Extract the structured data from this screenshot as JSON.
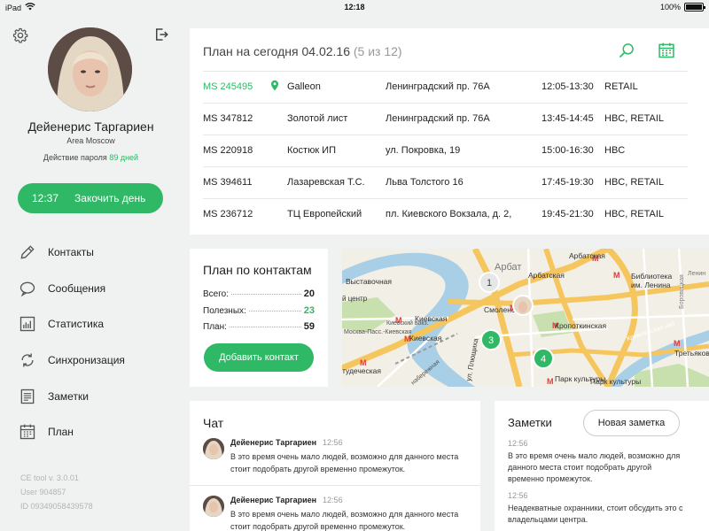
{
  "statusbar": {
    "device": "iPad",
    "time": "12:18",
    "battery_label": "100%",
    "battery_level": 1.0
  },
  "profile": {
    "name": "Дейенерис Таргариен",
    "region": "Area Moscow",
    "password_prefix": "Действие пароля",
    "password_days": "89 дней"
  },
  "end_day": {
    "time": "12:37",
    "label": "Закочить день"
  },
  "nav": [
    {
      "label": "Контакты",
      "icon": "pencil-icon"
    },
    {
      "label": "Сообщения",
      "icon": "chat-bubble-icon"
    },
    {
      "label": "Статистика",
      "icon": "bar-chart-icon"
    },
    {
      "label": "Синхронизация",
      "icon": "sync-icon"
    },
    {
      "label": "Заметки",
      "icon": "notes-icon"
    },
    {
      "label": "План",
      "icon": "calendar-icon"
    }
  ],
  "meta": {
    "version": "CE tool v. 3.0.01",
    "user": "User 904857",
    "id": "ID 09349058439578"
  },
  "plan": {
    "title": "План на сегодня 04.02.16",
    "count": "(5 из 12)",
    "rows": [
      {
        "id": "MS 245495",
        "name": "Galleon",
        "address": "Ленинградский пр. 76А",
        "time": "12:05-13:30",
        "type": "RETAIL"
      },
      {
        "id": "MS 347812",
        "name": "Золотой лист",
        "address": "Ленинградский пр. 76А",
        "time": "13:45-14:45",
        "type": "HBC, RETAIL"
      },
      {
        "id": "MS 220918",
        "name": "Костюк ИП",
        "address": "ул. Покровка, 19",
        "time": "15:00-16:30",
        "type": "HBC"
      },
      {
        "id": "MS 394611",
        "name": "Лазаревская Т.С.",
        "address": "Льва Толстого 16",
        "time": "17:45-19:30",
        "type": "HBC, RETAIL"
      },
      {
        "id": "MS 236712",
        "name": "ТЦ Европейский",
        "address": "пл. Киевского Вокзала, д. 2,",
        "time": "19:45-21:30",
        "type": "HBC, RETAIL"
      }
    ]
  },
  "contacts_plan": {
    "title": "План по контактам",
    "rows": [
      {
        "label": "Всего:",
        "value": "20"
      },
      {
        "label": "Полезных:",
        "value": "23"
      },
      {
        "label": "План:",
        "value": "59"
      }
    ],
    "button": "Добавить контакт"
  },
  "map": {
    "labels": [
      "Арбат",
      "Арбатская",
      "Арбатская",
      "Выставочная",
      "Смоленская",
      "Библиотека",
      "им. Ленина",
      "Киевская",
      "Киевский вокз.",
      "Москва-Пасс.-Киевская",
      "Киевская",
      "Кропоткинская",
      "Третьяковс",
      "тудеческая",
      "ул. Плющиха",
      "Парк культуры",
      "Парк культуры",
      "й центр",
      "Ленин",
      "Боровицкая",
      "Кремлёвская наб",
      "набережная"
    ],
    "markers": [
      "1",
      "3",
      "4"
    ],
    "colors": {
      "water": "#a8cfe6",
      "major_road": "#f6c65e",
      "green": "#c8dfae"
    }
  },
  "chat": {
    "title": "Чат",
    "messages": [
      {
        "author": "Дейенерис Таргариен",
        "time": "12:56",
        "text": "В это время очень мало людей, возможно для данного места стоит подобрать другой временно промежуток."
      },
      {
        "author": "Дейенерис Таргариен",
        "time": "12:56",
        "text": "В это время очень мало людей, возможно для данного места стоит подобрать другой временно промежуток."
      }
    ]
  },
  "notes": {
    "title": "Заметки",
    "button": "Новая заметка",
    "items": [
      {
        "time": "12:56",
        "text": "В это время очень мало людей, возможно для данного места стоит подобрать другой временно промежуток."
      },
      {
        "time": "12:56",
        "text": "Неадекватные охранники, стоит обсудить это с владельцами центра."
      }
    ]
  },
  "colors": {
    "accent": "#2fb866",
    "background": "#f0f1f1",
    "card": "#ffffff"
  }
}
